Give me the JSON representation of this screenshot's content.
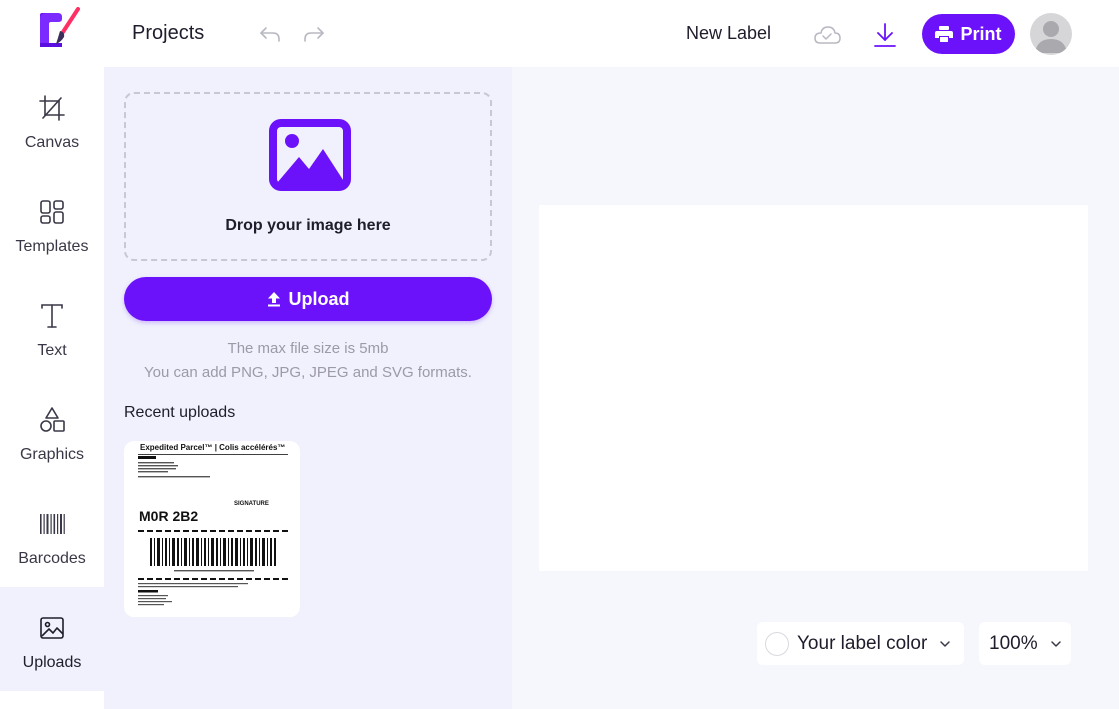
{
  "header": {
    "projects_label": "Projects",
    "label_name": "New Label",
    "print_label": "Print"
  },
  "sidenav": {
    "items": [
      {
        "label": "Canvas",
        "icon": "crop-icon"
      },
      {
        "label": "Templates",
        "icon": "templates-grid-icon"
      },
      {
        "label": "Text",
        "icon": "text-icon"
      },
      {
        "label": "Graphics",
        "icon": "shapes-icon"
      },
      {
        "label": "Barcodes",
        "icon": "barcode-icon"
      },
      {
        "label": "Uploads",
        "icon": "image-icon",
        "active": true
      }
    ]
  },
  "uploads": {
    "drop_text": "Drop your image here",
    "upload_label": "Upload",
    "hint_size": "The max file size is 5mb",
    "hint_formats": "You can add PNG, JPG, JPEG and SVG formats.",
    "recent_title": "Recent uploads",
    "recent_items": [
      {
        "heading": "Expedited Parcel™ | Colis accélérés™",
        "postal_code": "M0R 2B2",
        "signature": "SIGNATURE"
      }
    ]
  },
  "canvas": {
    "color_label": "Your label color",
    "zoom_label": "100%"
  },
  "colors": {
    "accent": "#6c12fb",
    "panel_bg": "#f0f1fc",
    "workspace_bg": "#f6f7fd"
  }
}
